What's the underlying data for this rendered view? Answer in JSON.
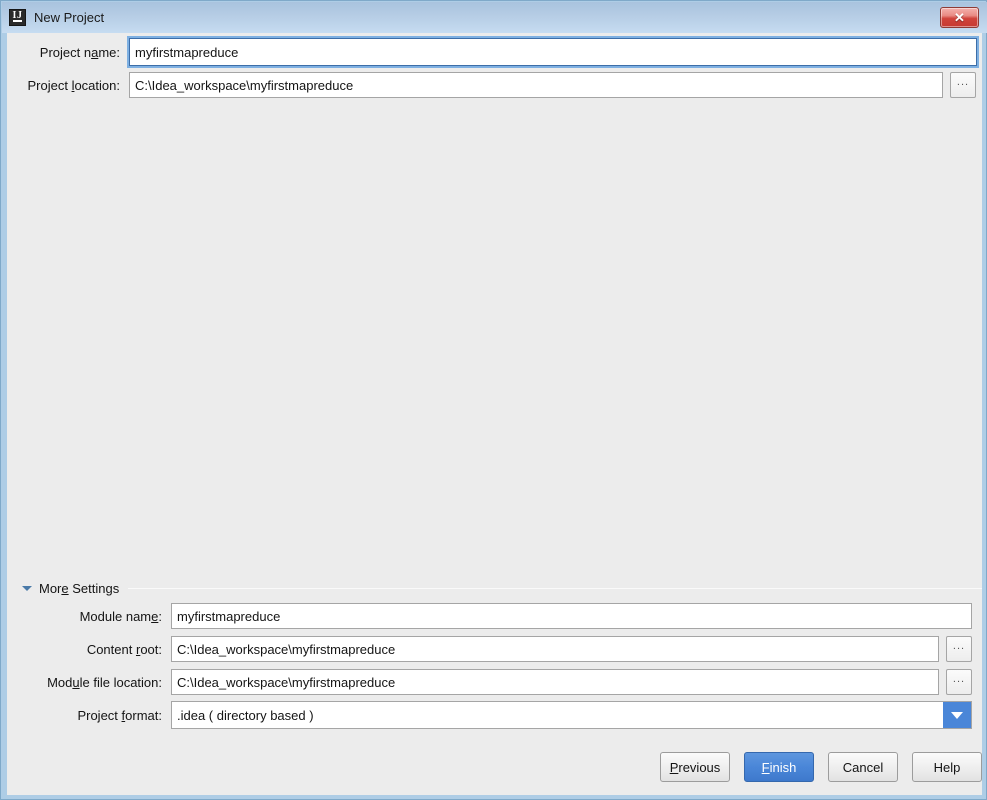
{
  "window": {
    "title": "New Project",
    "app_icon": "intellij-idea-icon",
    "close_icon": "✕"
  },
  "top_form": {
    "project_name": {
      "label_pre": "Project  n",
      "label_mnemonic": "a",
      "label_post": "me:",
      "value": "myfirstmapreduce"
    },
    "project_location": {
      "label_pre": "Project  ",
      "label_mnemonic": "l",
      "label_post": "ocation:",
      "value": "C:\\Idea_workspace\\myfirstmapreduce",
      "browse_label": "..."
    }
  },
  "more_settings": {
    "label_pre": "Mor",
    "label_mnemonic": "e",
    "label_post": "  Settings",
    "expanded": true,
    "chevron_icon": "triangle-down-icon"
  },
  "bottom_form": {
    "module_name": {
      "label_pre": "Module  nam",
      "label_mnemonic": "e",
      "label_post": ":",
      "value": "myfirstmapreduce"
    },
    "content_root": {
      "label_pre": "Content  ",
      "label_mnemonic": "r",
      "label_post": "oot:",
      "value": "C:\\Idea_workspace\\myfirstmapreduce",
      "browse_label": "..."
    },
    "module_file_location": {
      "label_pre": "Mod",
      "label_mnemonic": "u",
      "label_post": "le  file  location:",
      "value": "C:\\Idea_workspace\\myfirstmapreduce",
      "browse_label": "..."
    },
    "project_format": {
      "label_pre": "Project  ",
      "label_mnemonic": "f",
      "label_post": "ormat:",
      "value": ".idea  ( directory  based )",
      "arrow_icon": "chevron-down-icon"
    }
  },
  "buttons": {
    "previous": {
      "pre": "",
      "mnemonic": "P",
      "post": "revious"
    },
    "finish": {
      "pre": "",
      "mnemonic": "F",
      "post": "inish"
    },
    "cancel": {
      "pre": "Cancel",
      "mnemonic": "",
      "post": ""
    },
    "help": {
      "pre": "Help",
      "mnemonic": "",
      "post": ""
    }
  },
  "colors": {
    "accent_blue": "#4a86d8",
    "titlebar_blue": "#b6cde5",
    "dialog_bg": "#ececec",
    "close_red": "#c63a33"
  }
}
